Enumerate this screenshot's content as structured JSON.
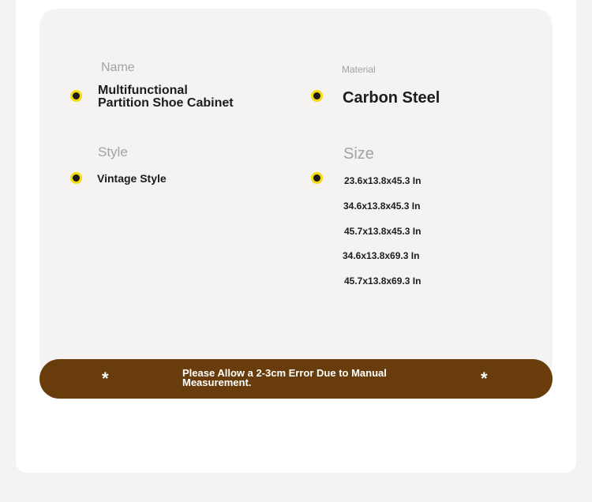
{
  "specs": {
    "name": {
      "label": "Name",
      "value_line1": "Multifunctional",
      "value_line2": "Partition Shoe Cabinet"
    },
    "material": {
      "label": "Material",
      "value": "Carbon Steel"
    },
    "style": {
      "label": "Style",
      "value": "Vintage Style"
    },
    "size": {
      "label": "Size",
      "options": [
        "23.6x13.8x45.3 In",
        "34.6x13.8x45.3 In",
        "45.7x13.8x45.3 In",
        "34.6x13.8x69.3 In",
        "45.7x13.8x69.3 In"
      ]
    }
  },
  "banner": {
    "text": "Please Allow a 2-3cm Error Due to Manual Measurement.",
    "star_left": "*",
    "star_right": "*"
  }
}
